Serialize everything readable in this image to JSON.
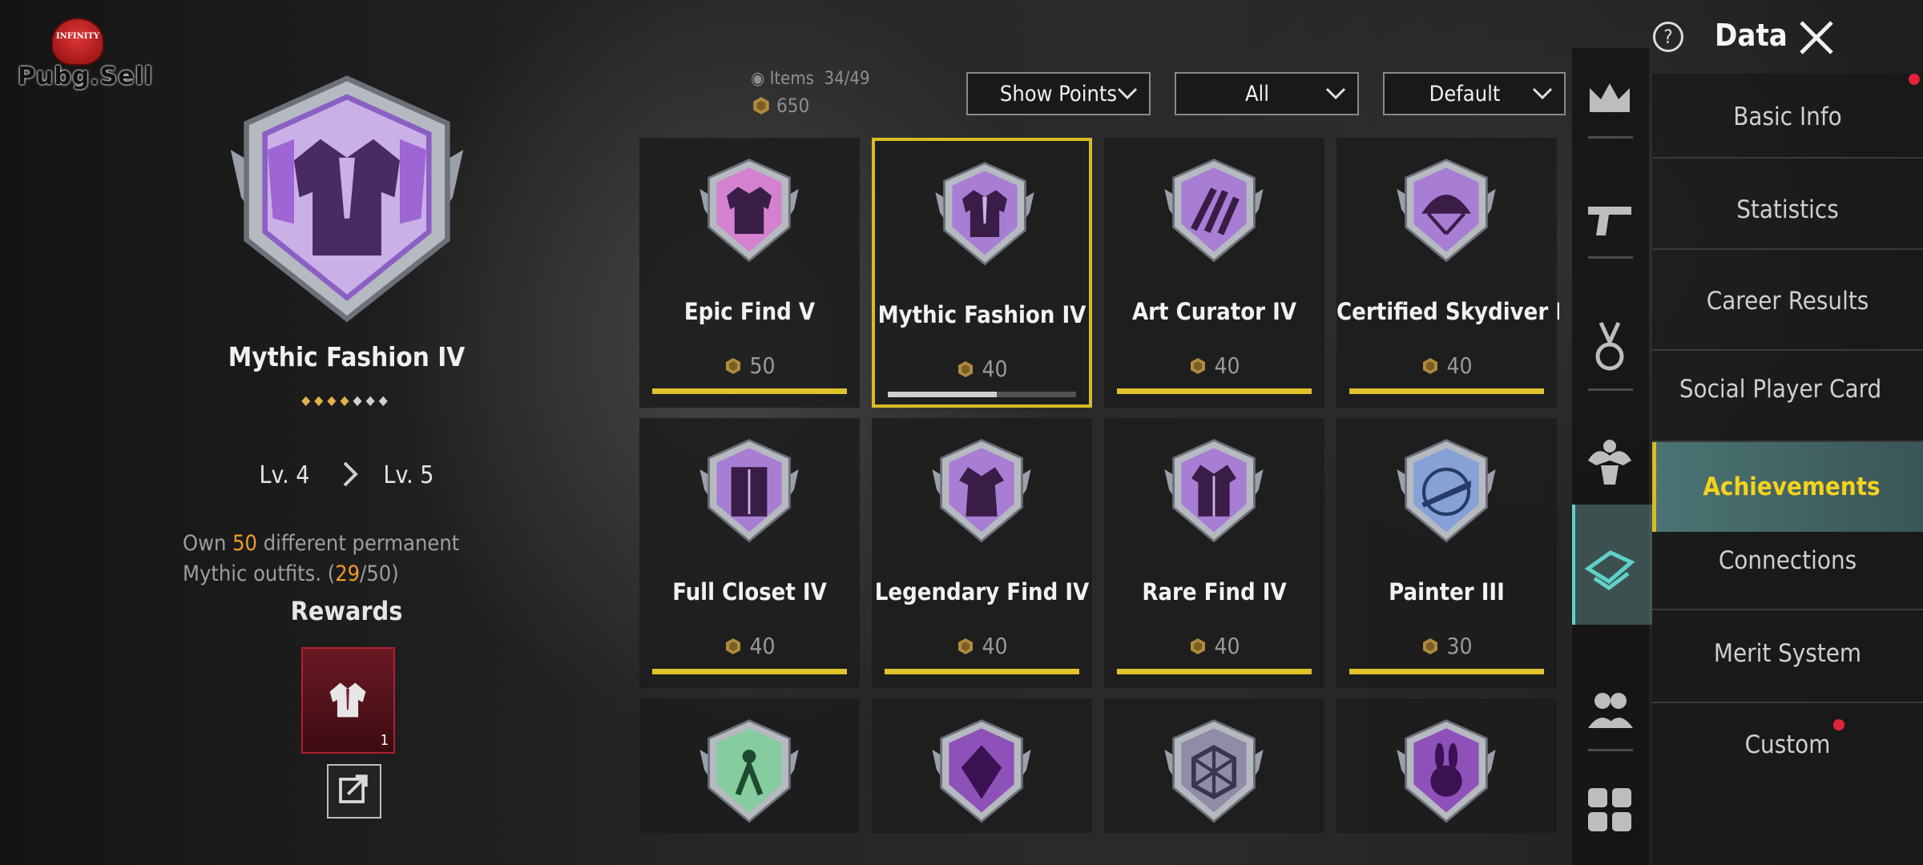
{
  "logo": {
    "badge_text": "INFINITY",
    "word": "Pubg.Sell"
  },
  "detail": {
    "title": "Mythic Fashion IV",
    "stars_filled": 4,
    "stars_total": 7,
    "level_from": "Lv. 4",
    "level_to": "Lv. 5",
    "desc_pre": "Own ",
    "desc_target": "50",
    "desc_post": " different permanent Mythic outfits. (",
    "desc_current": "29",
    "desc_total": "/50)",
    "rewards_title": "Rewards",
    "reward_qty": "1"
  },
  "stats": {
    "items_label": "Items",
    "items_value": "34/49",
    "points": "650"
  },
  "filters": {
    "points": "Show Points",
    "category": "All",
    "sort": "Default"
  },
  "achievements": [
    {
      "name": "Epic Find V",
      "points": "50",
      "progress": 1.0,
      "color": "#d77bd0",
      "icon": "jacket-icon"
    },
    {
      "name": "Mythic Fashion IV",
      "points": "40",
      "progress": 0.58,
      "color": "#a678d6",
      "icon": "suit-icon",
      "selected": true
    },
    {
      "name": "Art Curator IV",
      "points": "40",
      "progress": 1.0,
      "color": "#a678d6",
      "icon": "claw-icon"
    },
    {
      "name": "Certified Skydiver IV",
      "points": "40",
      "progress": 1.0,
      "color": "#a678d6",
      "icon": "parachute-icon"
    },
    {
      "name": "Full Closet IV",
      "points": "40",
      "progress": 1.0,
      "color": "#a678d6",
      "icon": "closet-icon"
    },
    {
      "name": "Legendary Find IV",
      "points": "40",
      "progress": 1.0,
      "color": "#a678d6",
      "icon": "robe-icon"
    },
    {
      "name": "Rare Find IV",
      "points": "40",
      "progress": 1.0,
      "color": "#a678d6",
      "icon": "coat-icon"
    },
    {
      "name": "Painter III",
      "points": "30",
      "progress": 1.0,
      "color": "#7f9fd8",
      "icon": "rifle-crosshair-icon"
    },
    {
      "name": "",
      "points": "",
      "progress": 0,
      "color": "#7fcf9a",
      "icon": "figure-icon"
    },
    {
      "name": "",
      "points": "",
      "progress": 0,
      "color": "#8a45b8",
      "icon": "gem-icon"
    },
    {
      "name": "",
      "points": "",
      "progress": 0,
      "color": "#8c86a3",
      "icon": "hexagon-icon"
    },
    {
      "name": "",
      "points": "",
      "progress": 0,
      "color": "#8a45b8",
      "icon": "rabbit-icon"
    }
  ],
  "side_icons": [
    "crown-icon",
    "pistol-icon",
    "medal-icon",
    "muscle-icon",
    "achievement-cards-icon",
    "friends-icon",
    "grid-icon"
  ],
  "menu": [
    "Basic Info",
    "Statistics",
    "Career Results",
    "Social Player Card",
    "Achievements",
    "Connections",
    "Merit System",
    "Custom"
  ],
  "header": {
    "title": "Data"
  },
  "colors": {
    "accent_yellow": "#d9bb25",
    "teal": "#5fd1c9",
    "red_dot": "#e2243b"
  }
}
